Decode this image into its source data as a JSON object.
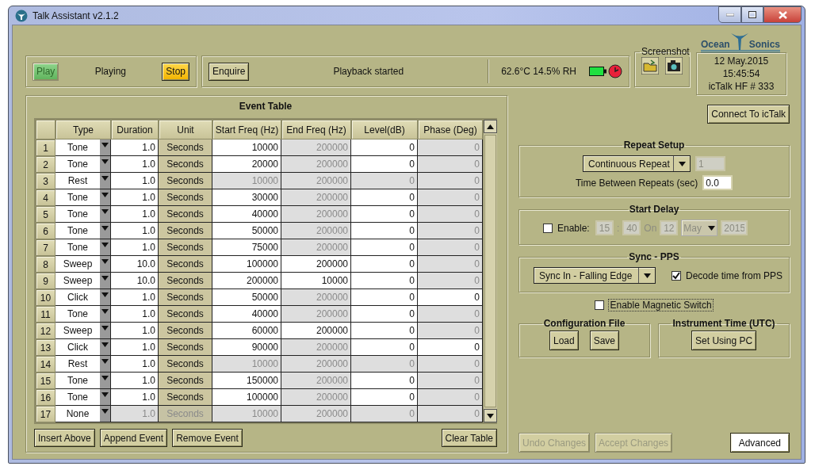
{
  "window": {
    "title": "Talk Assistant v2.1.2"
  },
  "playback": {
    "buttons": [
      {
        "label": "Play",
        "kind": "play",
        "disabled": true
      },
      {
        "label": "Stop",
        "kind": "stop",
        "disabled": false
      }
    ],
    "state": "Playing"
  },
  "status": {
    "button": "Enquire",
    "message": "Playback started",
    "environment": "62.6°C 14.5% RH"
  },
  "screenshot": {
    "title": "Screenshot"
  },
  "logo": {
    "left": "Ocean",
    "right": "Sonics"
  },
  "device": {
    "date": "12 May.2015",
    "time": "15:45:54",
    "name": "icTalk HF # 333"
  },
  "event_table": {
    "title": "Event Table",
    "columns": [
      "Type",
      "Duration",
      "Unit",
      "Start Freq (Hz)",
      "End Freq (Hz)",
      "Level(dB)",
      "Phase (Deg)"
    ],
    "rows": [
      {
        "number": "1",
        "cells": [
          {
            "text": "Tone",
            "disabled": false
          },
          {
            "text": "1.0",
            "disabled": false
          },
          {
            "text": "Seconds",
            "disabled": false
          },
          {
            "text": "10000",
            "disabled": false
          },
          {
            "text": "200000",
            "disabled": true
          },
          {
            "text": "0",
            "disabled": false
          },
          {
            "text": "0",
            "disabled": true
          }
        ]
      },
      {
        "number": "2",
        "cells": [
          {
            "text": "Tone",
            "disabled": false
          },
          {
            "text": "1.0",
            "disabled": false
          },
          {
            "text": "Seconds",
            "disabled": false
          },
          {
            "text": "20000",
            "disabled": false
          },
          {
            "text": "200000",
            "disabled": true
          },
          {
            "text": "0",
            "disabled": false
          },
          {
            "text": "0",
            "disabled": true
          }
        ]
      },
      {
        "number": "3",
        "cells": [
          {
            "text": "Rest",
            "disabled": false
          },
          {
            "text": "1.0",
            "disabled": false
          },
          {
            "text": "Seconds",
            "disabled": false
          },
          {
            "text": "10000",
            "disabled": true
          },
          {
            "text": "200000",
            "disabled": true
          },
          {
            "text": "0",
            "disabled": true
          },
          {
            "text": "0",
            "disabled": true
          }
        ]
      },
      {
        "number": "4",
        "cells": [
          {
            "text": "Tone",
            "disabled": false
          },
          {
            "text": "1.0",
            "disabled": false
          },
          {
            "text": "Seconds",
            "disabled": false
          },
          {
            "text": "30000",
            "disabled": false
          },
          {
            "text": "200000",
            "disabled": true
          },
          {
            "text": "0",
            "disabled": false
          },
          {
            "text": "0",
            "disabled": true
          }
        ]
      },
      {
        "number": "5",
        "cells": [
          {
            "text": "Tone",
            "disabled": false
          },
          {
            "text": "1.0",
            "disabled": false
          },
          {
            "text": "Seconds",
            "disabled": false
          },
          {
            "text": "40000",
            "disabled": false
          },
          {
            "text": "200000",
            "disabled": true
          },
          {
            "text": "0",
            "disabled": false
          },
          {
            "text": "0",
            "disabled": true
          }
        ]
      },
      {
        "number": "6",
        "cells": [
          {
            "text": "Tone",
            "disabled": false
          },
          {
            "text": "1.0",
            "disabled": false
          },
          {
            "text": "Seconds",
            "disabled": false
          },
          {
            "text": "50000",
            "disabled": false
          },
          {
            "text": "200000",
            "disabled": true
          },
          {
            "text": "0",
            "disabled": false
          },
          {
            "text": "0",
            "disabled": true
          }
        ]
      },
      {
        "number": "7",
        "cells": [
          {
            "text": "Tone",
            "disabled": false
          },
          {
            "text": "1.0",
            "disabled": false
          },
          {
            "text": "Seconds",
            "disabled": false
          },
          {
            "text": "75000",
            "disabled": false
          },
          {
            "text": "200000",
            "disabled": true
          },
          {
            "text": "0",
            "disabled": false
          },
          {
            "text": "0",
            "disabled": true
          }
        ]
      },
      {
        "number": "8",
        "cells": [
          {
            "text": "Sweep",
            "disabled": false
          },
          {
            "text": "10.0",
            "disabled": false
          },
          {
            "text": "Seconds",
            "disabled": false
          },
          {
            "text": "100000",
            "disabled": false
          },
          {
            "text": "200000",
            "disabled": false
          },
          {
            "text": "0",
            "disabled": false
          },
          {
            "text": "0",
            "disabled": true
          }
        ]
      },
      {
        "number": "9",
        "cells": [
          {
            "text": "Sweep",
            "disabled": false
          },
          {
            "text": "10.0",
            "disabled": false
          },
          {
            "text": "Seconds",
            "disabled": false
          },
          {
            "text": "200000",
            "disabled": false
          },
          {
            "text": "10000",
            "disabled": false
          },
          {
            "text": "0",
            "disabled": false
          },
          {
            "text": "0",
            "disabled": true
          }
        ]
      },
      {
        "number": "10",
        "cells": [
          {
            "text": "Click",
            "disabled": false
          },
          {
            "text": "1.0",
            "disabled": false
          },
          {
            "text": "Seconds",
            "disabled": false
          },
          {
            "text": "50000",
            "disabled": false
          },
          {
            "text": "200000",
            "disabled": true
          },
          {
            "text": "0",
            "disabled": false
          },
          {
            "text": "0",
            "disabled": false
          }
        ]
      },
      {
        "number": "11",
        "cells": [
          {
            "text": "Tone",
            "disabled": false
          },
          {
            "text": "1.0",
            "disabled": false
          },
          {
            "text": "Seconds",
            "disabled": false
          },
          {
            "text": "40000",
            "disabled": false
          },
          {
            "text": "200000",
            "disabled": true
          },
          {
            "text": "0",
            "disabled": false
          },
          {
            "text": "0",
            "disabled": true
          }
        ]
      },
      {
        "number": "12",
        "cells": [
          {
            "text": "Sweep",
            "disabled": false
          },
          {
            "text": "1.0",
            "disabled": false
          },
          {
            "text": "Seconds",
            "disabled": false
          },
          {
            "text": "60000",
            "disabled": false
          },
          {
            "text": "200000",
            "disabled": false
          },
          {
            "text": "0",
            "disabled": false
          },
          {
            "text": "0",
            "disabled": true
          }
        ]
      },
      {
        "number": "13",
        "cells": [
          {
            "text": "Click",
            "disabled": false
          },
          {
            "text": "1.0",
            "disabled": false
          },
          {
            "text": "Seconds",
            "disabled": false
          },
          {
            "text": "90000",
            "disabled": false
          },
          {
            "text": "200000",
            "disabled": true
          },
          {
            "text": "0",
            "disabled": false
          },
          {
            "text": "0",
            "disabled": false
          }
        ]
      },
      {
        "number": "14",
        "cells": [
          {
            "text": "Rest",
            "disabled": false
          },
          {
            "text": "1.0",
            "disabled": false
          },
          {
            "text": "Seconds",
            "disabled": false
          },
          {
            "text": "10000",
            "disabled": true
          },
          {
            "text": "200000",
            "disabled": true
          },
          {
            "text": "0",
            "disabled": true
          },
          {
            "text": "0",
            "disabled": true
          }
        ]
      },
      {
        "number": "15",
        "cells": [
          {
            "text": "Tone",
            "disabled": false
          },
          {
            "text": "1.0",
            "disabled": false
          },
          {
            "text": "Seconds",
            "disabled": false
          },
          {
            "text": "150000",
            "disabled": false
          },
          {
            "text": "200000",
            "disabled": true
          },
          {
            "text": "0",
            "disabled": false
          },
          {
            "text": "0",
            "disabled": true
          }
        ]
      },
      {
        "number": "16",
        "cells": [
          {
            "text": "Tone",
            "disabled": false
          },
          {
            "text": "1.0",
            "disabled": false
          },
          {
            "text": "Seconds",
            "disabled": false
          },
          {
            "text": "100000",
            "disabled": false
          },
          {
            "text": "200000",
            "disabled": true
          },
          {
            "text": "0",
            "disabled": false
          },
          {
            "text": "0",
            "disabled": true
          }
        ]
      },
      {
        "number": "17",
        "cells": [
          {
            "text": "None",
            "disabled": false
          },
          {
            "text": "1.0",
            "disabled": true
          },
          {
            "text": "Seconds",
            "disabled": true
          },
          {
            "text": "10000",
            "disabled": true
          },
          {
            "text": "200000",
            "disabled": true
          },
          {
            "text": "0",
            "disabled": true
          },
          {
            "text": "0",
            "disabled": true
          }
        ]
      }
    ],
    "actions": [
      "Insert Above",
      "Append Event",
      "Remove Event"
    ],
    "clear": "Clear Table"
  },
  "connect": "Connect To icTalk",
  "repeat_setup": {
    "title": "Repeat Setup",
    "mode": "Continuous Repeat",
    "count": {
      "value": "1",
      "disabled": true
    },
    "interval_label": "Time Between Repeats (sec)",
    "interval": "0.0"
  },
  "start_delay": {
    "title": "Start Delay",
    "enable": {
      "label": "Enable:",
      "checked": false
    },
    "hour": "15",
    "separator": ":",
    "minute": "40",
    "on": "On",
    "day": "12",
    "month": "May",
    "year": "2015"
  },
  "sync": {
    "title": "Sync - PPS",
    "mode": "Sync In - Falling Edge",
    "decode": {
      "label": "Decode time from PPS",
      "checked": true
    }
  },
  "magnetic_switch": {
    "label": "Enable Magnetic Switch",
    "checked": false
  },
  "config_file": {
    "title": "Configuration File",
    "buttons": [
      "Load",
      "Save"
    ]
  },
  "instrument_time": {
    "title": "Instrument Time (UTC)",
    "button": "Set Using PC"
  },
  "footer": [
    {
      "label": "Undo Changes",
      "disabled": true,
      "kind": "normal"
    },
    {
      "label": "Accept Changes",
      "disabled": true,
      "kind": "normal"
    },
    {
      "label": "Advanced",
      "disabled": false,
      "kind": "default"
    }
  ]
}
